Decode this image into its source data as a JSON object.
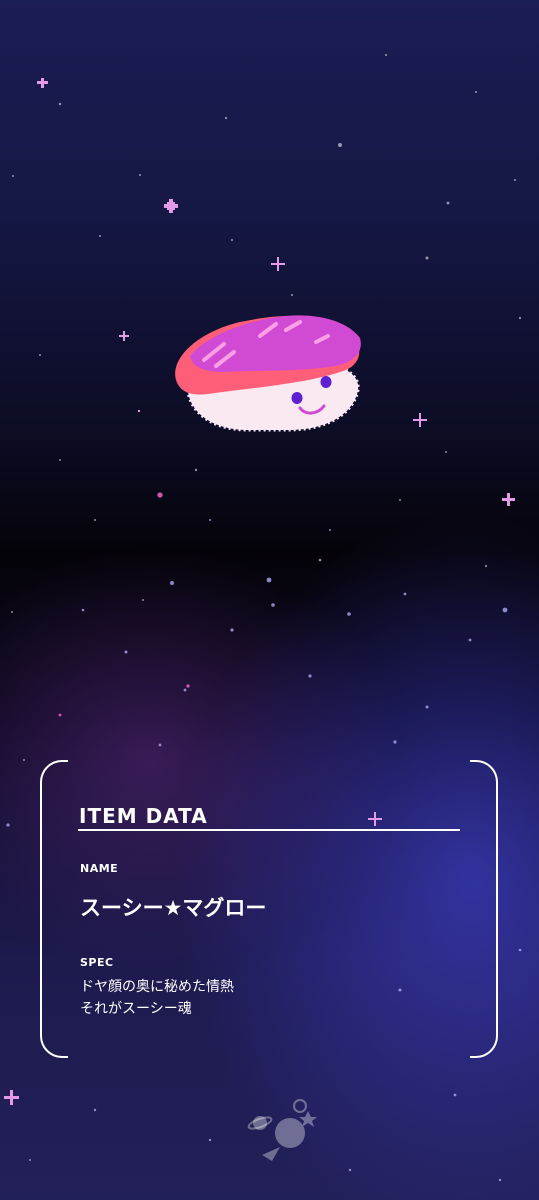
{
  "item_card": {
    "title": "ITEM DATA",
    "name_label": "NAME",
    "name_value": "スーシー★マグロー",
    "spec_label": "SPEC",
    "spec_lines": [
      "ドヤ顔の奥に秘めた情熱",
      "それがスーシー魂"
    ]
  },
  "character": {
    "icon": "maguro-sushi-character-icon"
  },
  "footer": {
    "icon": "space-planet-logo-icon"
  },
  "colors": {
    "sparkle": "#e59ae8",
    "tuna_top": "#d14ad3",
    "tuna_base": "#ff5e78",
    "rice": "#fbe9f2",
    "face": "#5d1fd0",
    "text": "#ffffff"
  }
}
